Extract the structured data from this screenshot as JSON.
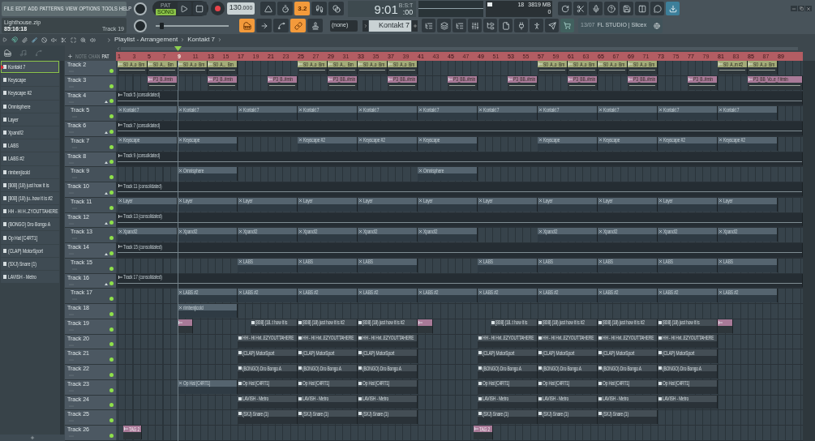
{
  "menu": [
    "FILE",
    "EDIT",
    "ADD",
    "PATTERNS",
    "VIEW",
    "OPTIONS",
    "TOOLS",
    "HELP"
  ],
  "project": {
    "file": "Lighthouse.zip",
    "time": "85:16:18",
    "hint": "Track 19"
  },
  "transport": {
    "modes": [
      {
        "label": "PAT",
        "selected": false
      },
      {
        "label": "SONG",
        "selected": true
      }
    ],
    "tempo": "130",
    "tempo_fraction": ".000"
  },
  "master_pitch": {
    "level": 0.08
  },
  "toggles_top": [
    {
      "kind": "metronome",
      "on": false
    },
    {
      "kind": "wait",
      "on": false
    },
    {
      "kind": "countdown",
      "label": "3.2",
      "on": true
    },
    {
      "kind": "step",
      "on": false
    },
    {
      "kind": "blend",
      "on": false
    }
  ],
  "toggles_bottom": [
    {
      "kind": "typing",
      "on": true
    },
    {
      "kind": "arrow",
      "on": false
    },
    {
      "kind": "curve",
      "on": false
    },
    {
      "kind": "link",
      "on": true
    },
    {
      "kind": "stamp",
      "on": false
    }
  ],
  "clock": {
    "main": "9:01",
    "sub": ":00",
    "unit": "B:S:T"
  },
  "cpu": {
    "voices": "18",
    "memory": "3819 MB",
    "polyphony": "0"
  },
  "snap": "(none)",
  "pattern": "Kontakt 7",
  "news": {
    "date": "13/07",
    "text": "FL STUDIO | Slicex"
  },
  "playlist": {
    "title": "Playlist - Arrangement",
    "pattern": "Kontakt 7",
    "picker_tabs": [
      {
        "label": "NOTE",
        "selected": false
      },
      {
        "label": "CHAN",
        "selected": false
      },
      {
        "label": "PAT",
        "selected": true
      }
    ],
    "ruler": [
      {
        "label": "1",
        "playhead": false
      },
      {
        "label": "3",
        "playhead": false
      },
      {
        "label": "5",
        "playhead": false
      },
      {
        "label": "7",
        "playhead": false
      },
      {
        "label": "9",
        "playhead": true
      },
      {
        "label": "11",
        "playhead": false
      },
      {
        "label": "13",
        "playhead": false
      },
      {
        "label": "15",
        "playhead": false
      },
      {
        "label": "17",
        "playhead": false
      },
      {
        "label": "19",
        "playhead": false
      },
      {
        "label": "21",
        "playhead": false
      },
      {
        "label": "23",
        "playhead": false
      },
      {
        "label": "25",
        "playhead": false
      },
      {
        "label": "27",
        "playhead": false
      },
      {
        "label": "29",
        "playhead": false
      },
      {
        "label": "31",
        "playhead": false
      },
      {
        "label": "33",
        "playhead": false
      },
      {
        "label": "35",
        "playhead": false
      },
      {
        "label": "37",
        "playhead": false
      },
      {
        "label": "39",
        "playhead": false
      },
      {
        "label": "41",
        "playhead": false
      },
      {
        "label": "43",
        "playhead": false
      },
      {
        "label": "45",
        "playhead": false
      },
      {
        "label": "47",
        "playhead": false
      },
      {
        "label": "49",
        "playhead": false
      },
      {
        "label": "51",
        "playhead": false
      },
      {
        "label": "53",
        "playhead": false
      },
      {
        "label": "55",
        "playhead": false
      },
      {
        "label": "57",
        "playhead": false
      },
      {
        "label": "59",
        "playhead": false
      },
      {
        "label": "61",
        "playhead": false
      },
      {
        "label": "63",
        "playhead": false
      },
      {
        "label": "65",
        "playhead": false
      },
      {
        "label": "67",
        "playhead": false
      },
      {
        "label": "69",
        "playhead": false
      },
      {
        "label": "71",
        "playhead": false
      },
      {
        "label": "73",
        "playhead": false
      },
      {
        "label": "75",
        "playhead": false
      },
      {
        "label": "77",
        "playhead": false
      },
      {
        "label": "79",
        "playhead": false
      },
      {
        "label": "81",
        "playhead": false
      },
      {
        "label": "83",
        "playhead": false
      },
      {
        "label": "85",
        "playhead": false
      },
      {
        "label": "87",
        "playhead": false
      },
      {
        "label": "89",
        "playhead": false
      }
    ],
    "channels": [
      {
        "name": "Kontakt 7",
        "selected": true
      },
      {
        "name": "Keyscape",
        "selected": false
      },
      {
        "name": "Keyscape #2",
        "selected": false
      },
      {
        "name": "Omnisphere",
        "selected": false
      },
      {
        "name": "Layer",
        "selected": false
      },
      {
        "name": "Xpand!2",
        "selected": false
      },
      {
        "name": "LABS",
        "selected": false
      },
      {
        "name": "LABS #2",
        "selected": false
      },
      {
        "name": "rimbenjicold",
        "selected": false
      },
      {
        "name": "[808] (18) just how it is",
        "selected": false
      },
      {
        "name": "[808] (18) ju..how it is #2",
        "selected": false
      },
      {
        "name": "HH - Hi H..ZYOUTTAHERE",
        "selected": false
      },
      {
        "name": "(BONGO) Dro Bongo A",
        "selected": false
      },
      {
        "name": "Op Hat [C4RT1]",
        "selected": false
      },
      {
        "name": "(CLAP) MotorSport",
        "selected": false
      },
      {
        "name": "(SXJ) Snare (1)",
        "selected": false
      },
      {
        "name": "LAVISH - Metro",
        "selected": false
      }
    ],
    "tracks": [
      {
        "name": "Track 2",
        "enabled": true,
        "clips": [
          {
            "kind": "pattern",
            "label": "S0_A..o_Bm",
            "color": "#a3ab78"
          },
          {
            "kind": "pattern",
            "label": "S0_A..._Bm",
            "color": "#a3ab78"
          },
          {
            "kind": "pattern",
            "label": "S0_A..o_Bm",
            "color": "#a3ab78"
          },
          {
            "kind": "pattern",
            "label": "S0_A..._Bm",
            "color": "#a3ab78"
          },
          {
            "kind": "pattern",
            "label": "S0_A..o_Bm",
            "color": "#a3ab78"
          },
          {
            "kind": "pattern",
            "label": "S0_A..._Bm",
            "color": "#a3ab78"
          },
          {
            "kind": "pattern",
            "label": "S0_A..o_Bm",
            "color": "#a3ab78"
          },
          {
            "kind": "pattern",
            "label": "S0_A..o_Bm",
            "color": "#a3ab78"
          },
          {
            "kind": "pattern",
            "label": "S0_A..o_Bm",
            "color": "#a3ab78"
          },
          {
            "kind": "pattern",
            "label": "S0_A..o_Bm",
            "color": "#a3ab78"
          },
          {
            "kind": "pattern",
            "label": "S0_A..o_Bm",
            "color": "#a3ab78"
          },
          {
            "kind": "pattern",
            "label": "S0_A..o_Bm",
            "color": "#a3ab78"
          },
          {
            "kind": "pattern",
            "label": "S0_A..m #2",
            "color": "#a3ab78"
          },
          {
            "kind": "pattern",
            "label": "S0_A..o_Bm",
            "color": "#a3ab78"
          }
        ]
      },
      {
        "name": "Track 3",
        "enabled": true,
        "clips": [
          {
            "kind": "pattern",
            "label": "P3_B..#min",
            "color": "#a97a98"
          },
          {
            "kind": "pattern",
            "label": "P3_B..#min",
            "color": "#a97a98"
          },
          {
            "kind": "pattern",
            "label": "P3_B..#min",
            "color": "#a97a98"
          },
          {
            "kind": "pattern",
            "label": "P3_BB..#min",
            "color": "#a97a98"
          },
          {
            "kind": "pattern",
            "label": "P3_BB..#min",
            "color": "#a97a98"
          },
          {
            "kind": "pattern",
            "label": "P3_BB..#min",
            "color": "#a97a98"
          },
          {
            "kind": "pattern",
            "label": "P3_BB..#min",
            "color": "#a97a98"
          },
          {
            "kind": "pattern",
            "label": "P3_BB..#min",
            "color": "#a97a98"
          },
          {
            "kind": "pattern",
            "label": "P3_BB..#min",
            "color": "#a97a98"
          },
          {
            "kind": "pattern",
            "label": "P3_B..#min",
            "color": "#a97a98"
          },
          {
            "kind": "pattern",
            "label": "P3_BB_Vo..e_f #min",
            "color": "#a97a98"
          }
        ]
      },
      {
        "name": "Track 4",
        "enabled": true,
        "expanded": true,
        "clips": [
          {
            "kind": "audio",
            "label": "Track 5 (consolidated)"
          }
        ],
        "children": [
          {
            "name": "Track 5",
            "enabled": true,
            "clips": [
              {
                "kind": "instrument",
                "label": "Kontakt 7"
              },
              {
                "kind": "instrument",
                "label": "Kontakt 7"
              },
              {
                "kind": "instrument",
                "label": "Kontakt 7"
              },
              {
                "kind": "instrument",
                "label": "Kontakt 7"
              },
              {
                "kind": "instrument",
                "label": "Kontakt 7"
              },
              {
                "kind": "instrument",
                "label": "Kontakt 7"
              },
              {
                "kind": "instrument",
                "label": "Kontakt 7"
              },
              {
                "kind": "instrument",
                "label": "Kontakt 7"
              },
              {
                "kind": "instrument",
                "label": "Kontakt 7"
              },
              {
                "kind": "instrument",
                "label": "Kontakt 7"
              },
              {
                "kind": "instrument",
                "label": "Kontakt 7"
              }
            ]
          }
        ]
      },
      {
        "name": "Track 6",
        "enabled": true,
        "expanded": true,
        "clips": [
          {
            "kind": "audio",
            "label": "Track 7 (consolidated)"
          }
        ],
        "children": [
          {
            "name": "Track 7",
            "enabled": true,
            "clips": [
              {
                "kind": "instrument",
                "label": "Keyscape"
              },
              {
                "kind": "instrument",
                "label": "Keyscape"
              },
              {
                "kind": "instrument",
                "label": "Keyscape #2"
              },
              {
                "kind": "instrument",
                "label": "Keyscape #2"
              },
              {
                "kind": "instrument",
                "label": "Keyscape"
              },
              {
                "kind": "instrument",
                "label": "Keyscape"
              },
              {
                "kind": "instrument",
                "label": "Keyscape"
              },
              {
                "kind": "instrument",
                "label": "Keyscape #2"
              },
              {
                "kind": "instrument",
                "label": "Keyscape #2"
              }
            ]
          }
        ]
      },
      {
        "name": "Track 8",
        "enabled": true,
        "expanded": true,
        "clips": [
          {
            "kind": "audio",
            "label": "Track 9 (consolidated)"
          }
        ],
        "children": [
          {
            "name": "Track 9",
            "enabled": true,
            "clips": [
              {
                "kind": "instrument",
                "label": "Omnisphere"
              },
              {
                "kind": "instrument",
                "label": "Omnisphere"
              }
            ]
          }
        ]
      },
      {
        "name": "Track 10",
        "enabled": true,
        "expanded": true,
        "clips": [
          {
            "kind": "audio",
            "label": "Track 11 (consolidated)"
          }
        ],
        "children": [
          {
            "name": "Track 11",
            "enabled": true,
            "clips": [
              {
                "kind": "instrument",
                "label": "Layer"
              },
              {
                "kind": "instrument",
                "label": "Layer"
              },
              {
                "kind": "instrument",
                "label": "Layer"
              },
              {
                "kind": "instrument",
                "label": "Layer"
              },
              {
                "kind": "instrument",
                "label": "Layer"
              },
              {
                "kind": "instrument",
                "label": "Layer"
              },
              {
                "kind": "instrument",
                "label": "Layer"
              },
              {
                "kind": "instrument",
                "label": "Layer"
              },
              {
                "kind": "instrument",
                "label": "Layer"
              },
              {
                "kind": "instrument",
                "label": "Layer"
              },
              {
                "kind": "instrument",
                "label": "Layer"
              }
            ]
          }
        ]
      },
      {
        "name": "Track 12",
        "enabled": true,
        "expanded": true,
        "clips": [
          {
            "kind": "audio",
            "label": "Track 13 (consolidated)"
          }
        ],
        "children": [
          {
            "name": "Track 13",
            "enabled": true,
            "clips": [
              {
                "kind": "instrument",
                "label": "Xpand!2"
              },
              {
                "kind": "instrument",
                "label": "Xpand!2"
              },
              {
                "kind": "instrument",
                "label": "Xpand!2"
              },
              {
                "kind": "instrument",
                "label": "Xpand!2"
              },
              {
                "kind": "instrument",
                "label": "Xpand!2"
              },
              {
                "kind": "instrument",
                "label": "Xpand!2"
              },
              {
                "kind": "instrument",
                "label": "Xpand!2"
              },
              {
                "kind": "instrument",
                "label": "Xpand!2"
              },
              {
                "kind": "instrument",
                "label": "Xpand!2"
              },
              {
                "kind": "instrument",
                "label": "Xpand!2"
              }
            ]
          }
        ]
      },
      {
        "name": "Track 14",
        "enabled": true,
        "expanded": true,
        "clips": [
          {
            "kind": "audio",
            "label": "Track 15 (consolidated)"
          }
        ],
        "children": [
          {
            "name": "Track 15",
            "enabled": true,
            "clips": [
              {
                "kind": "instrument",
                "label": "LABS"
              },
              {
                "kind": "instrument",
                "label": "LABS"
              },
              {
                "kind": "instrument",
                "label": "LABS"
              },
              {
                "kind": "instrument",
                "label": "LABS"
              },
              {
                "kind": "instrument",
                "label": "LABS"
              },
              {
                "kind": "instrument",
                "label": "LABS"
              },
              {
                "kind": "instrument",
                "label": "LABS"
              },
              {
                "kind": "instrument",
                "label": "LABS"
              }
            ]
          }
        ]
      },
      {
        "name": "Track 16",
        "enabled": true,
        "expanded": true,
        "clips": [
          {
            "kind": "audio",
            "label": "Track 17 (consolidated)"
          }
        ],
        "children": [
          {
            "name": "Track 17",
            "enabled": true,
            "clips": [
              {
                "kind": "instrument",
                "label": "LABS #2"
              },
              {
                "kind": "instrument",
                "label": "LABS #2"
              },
              {
                "kind": "instrument",
                "label": "LABS #2"
              },
              {
                "kind": "instrument",
                "label": "LABS #2"
              },
              {
                "kind": "instrument",
                "label": "LABS #2"
              },
              {
                "kind": "instrument",
                "label": "LABS #2"
              },
              {
                "kind": "instrument",
                "label": "LABS #2"
              },
              {
                "kind": "instrument",
                "label": "LABS #2"
              },
              {
                "kind": "instrument",
                "label": "LABS #2"
              },
              {
                "kind": "instrument",
                "label": "LABS #2"
              }
            ]
          }
        ]
      },
      {
        "name": "Track 18",
        "enabled": true,
        "clips": [
          {
            "kind": "instrument",
            "label": "rimbenjicold"
          }
        ]
      },
      {
        "name": "Track 19",
        "enabled": true,
        "clips": [
          {
            "kind": "marker",
            "color": "#a97a98"
          },
          {
            "kind": "sample",
            "label": "[808] (18..t how it is"
          },
          {
            "kind": "sample",
            "label": "[808] (18) just how it is #2"
          },
          {
            "kind": "sample",
            "label": "[808] (18) just how it is #2"
          },
          {
            "kind": "marker",
            "color": "#a97a98"
          },
          {
            "kind": "sample",
            "label": "[808] (18..t how it is"
          },
          {
            "kind": "sample",
            "label": "[808] (18) just how it is #2"
          },
          {
            "kind": "sample",
            "label": "[808] (18) just how it is #2"
          },
          {
            "kind": "sample",
            "label": "[808] (18) just how it is"
          },
          {
            "kind": "marker",
            "color": "#a97a98"
          }
        ]
      },
      {
        "name": "Track 20",
        "enabled": true,
        "clips": [
          {
            "kind": "sample",
            "label": "HH - Hi Hvt..EZYOUTTAHERE"
          },
          {
            "kind": "sample",
            "label": "HH - Hi Hvt..EZYOUTTAHERE"
          },
          {
            "kind": "sample",
            "label": "HH - Hi Hvt..EZYOUTTAHERE"
          },
          {
            "kind": "sample",
            "label": "HH - Hi Hvt..EZYOUTTAHERE"
          },
          {
            "kind": "sample",
            "label": "HH - Hi Hvt..EZYOUTTAHERE"
          },
          {
            "kind": "sample",
            "label": "HH - Hi Hvt..EZYOUTTAHERE"
          },
          {
            "kind": "sample",
            "label": "HH - Hi Hvt..EZYOUTTAHERE"
          }
        ]
      },
      {
        "name": "Track 21",
        "enabled": true,
        "clips": [
          {
            "kind": "sample",
            "label": "(CLAP) MotorSport"
          },
          {
            "kind": "sample",
            "label": "(CLAP) MotorSport"
          },
          {
            "kind": "sample",
            "label": "(CLAP) MotorSport"
          },
          {
            "kind": "sample",
            "label": "(CLAP) MotorSport"
          },
          {
            "kind": "sample",
            "label": "(CLAP) MotorSport"
          },
          {
            "kind": "sample",
            "label": "(CLAP) MotorSport"
          },
          {
            "kind": "sample",
            "label": "(CLAP) MotorSport"
          }
        ]
      },
      {
        "name": "Track 22",
        "enabled": true,
        "clips": [
          {
            "kind": "sample",
            "label": "(BONGO) Dro Bongo A"
          },
          {
            "kind": "sample",
            "label": "(BONGO) Dro Bongo A"
          },
          {
            "kind": "sample",
            "label": "(BONGO) Dro Bongo A"
          },
          {
            "kind": "sample",
            "label": "(BONGO) Dro Bongo A"
          },
          {
            "kind": "sample",
            "label": "(BONGO) Dro Bongo A"
          },
          {
            "kind": "sample",
            "label": "(BONGO) Dro Bongo A"
          },
          {
            "kind": "sample",
            "label": "(BONGO) Dro Bongo A"
          }
        ]
      },
      {
        "name": "Track 23",
        "enabled": true,
        "clips": [
          {
            "kind": "instrument",
            "label": "Op Hat [C4RT1]"
          },
          {
            "kind": "sample",
            "label": "Op Hat [C4RT1]"
          },
          {
            "kind": "sample",
            "label": "Op Hat [C4RT1]"
          },
          {
            "kind": "sample",
            "label": "Op Hat [C4RT1]"
          },
          {
            "kind": "sample",
            "label": "Op Hat [C4RT1]"
          },
          {
            "kind": "sample",
            "label": "Op Hat [C4RT1]"
          },
          {
            "kind": "sample",
            "label": "Op Hat [C4RT1]"
          },
          {
            "kind": "sample",
            "label": "Op Hat [C4RT1]"
          }
        ]
      },
      {
        "name": "Track 24",
        "enabled": true,
        "clips": [
          {
            "kind": "sample",
            "label": "LAVISH - Metro"
          },
          {
            "kind": "sample",
            "label": "LAVISH - Metro"
          },
          {
            "kind": "sample",
            "label": "LAVISH - Metro"
          },
          {
            "kind": "sample",
            "label": "LAVISH - Metro"
          },
          {
            "kind": "sample",
            "label": "LAVISH - Metro"
          },
          {
            "kind": "sample",
            "label": "LAVISH - Metro"
          },
          {
            "kind": "sample",
            "label": "LAVISH - Metro"
          }
        ]
      },
      {
        "name": "Track 25",
        "enabled": true,
        "clips": [
          {
            "kind": "sample",
            "label": "(SXJ) Snare (1)"
          },
          {
            "kind": "sample",
            "label": "(SXJ) Snare (1)"
          },
          {
            "kind": "sample",
            "label": "(SXJ) Snare (1)"
          },
          {
            "kind": "sample",
            "label": "(SXJ) Snare (1)"
          },
          {
            "kind": "sample",
            "label": "(SXJ) Snare (1)"
          },
          {
            "kind": "sample",
            "label": "(SXJ) Snare (1)"
          }
        ]
      },
      {
        "name": "Track 26",
        "enabled": true,
        "clips": [
          {
            "kind": "marker",
            "label": "TAG 2",
            "color": "#a97a98"
          },
          {
            "kind": "marker",
            "label": "TAG 2",
            "color": "#a97a98"
          }
        ]
      }
    ]
  }
}
